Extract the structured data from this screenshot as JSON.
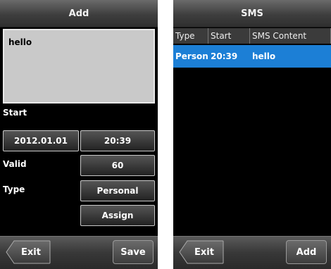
{
  "add_screen": {
    "title": "Add",
    "message_text": "hello",
    "start_label": "Start",
    "start_date": "2012.01.01",
    "start_time": "20:39",
    "valid_label": "Valid",
    "valid_value": "60",
    "type_label": "Type",
    "type_value": "Personal",
    "assign_label": "Assign",
    "exit_label": "Exit",
    "save_label": "Save"
  },
  "sms_screen": {
    "title": "SMS",
    "columns": [
      "Type",
      "Start",
      "SMS Content"
    ],
    "rows": [
      {
        "type": "Personal",
        "start": "20:39",
        "content": "hello"
      }
    ],
    "exit_label": "Exit",
    "add_label": "Add"
  },
  "colors": {
    "selected_row": "#1c7fd6",
    "background": "#000000",
    "text_area": "#c9c9c9"
  },
  "icons": [
    "back-arrow-icon"
  ]
}
